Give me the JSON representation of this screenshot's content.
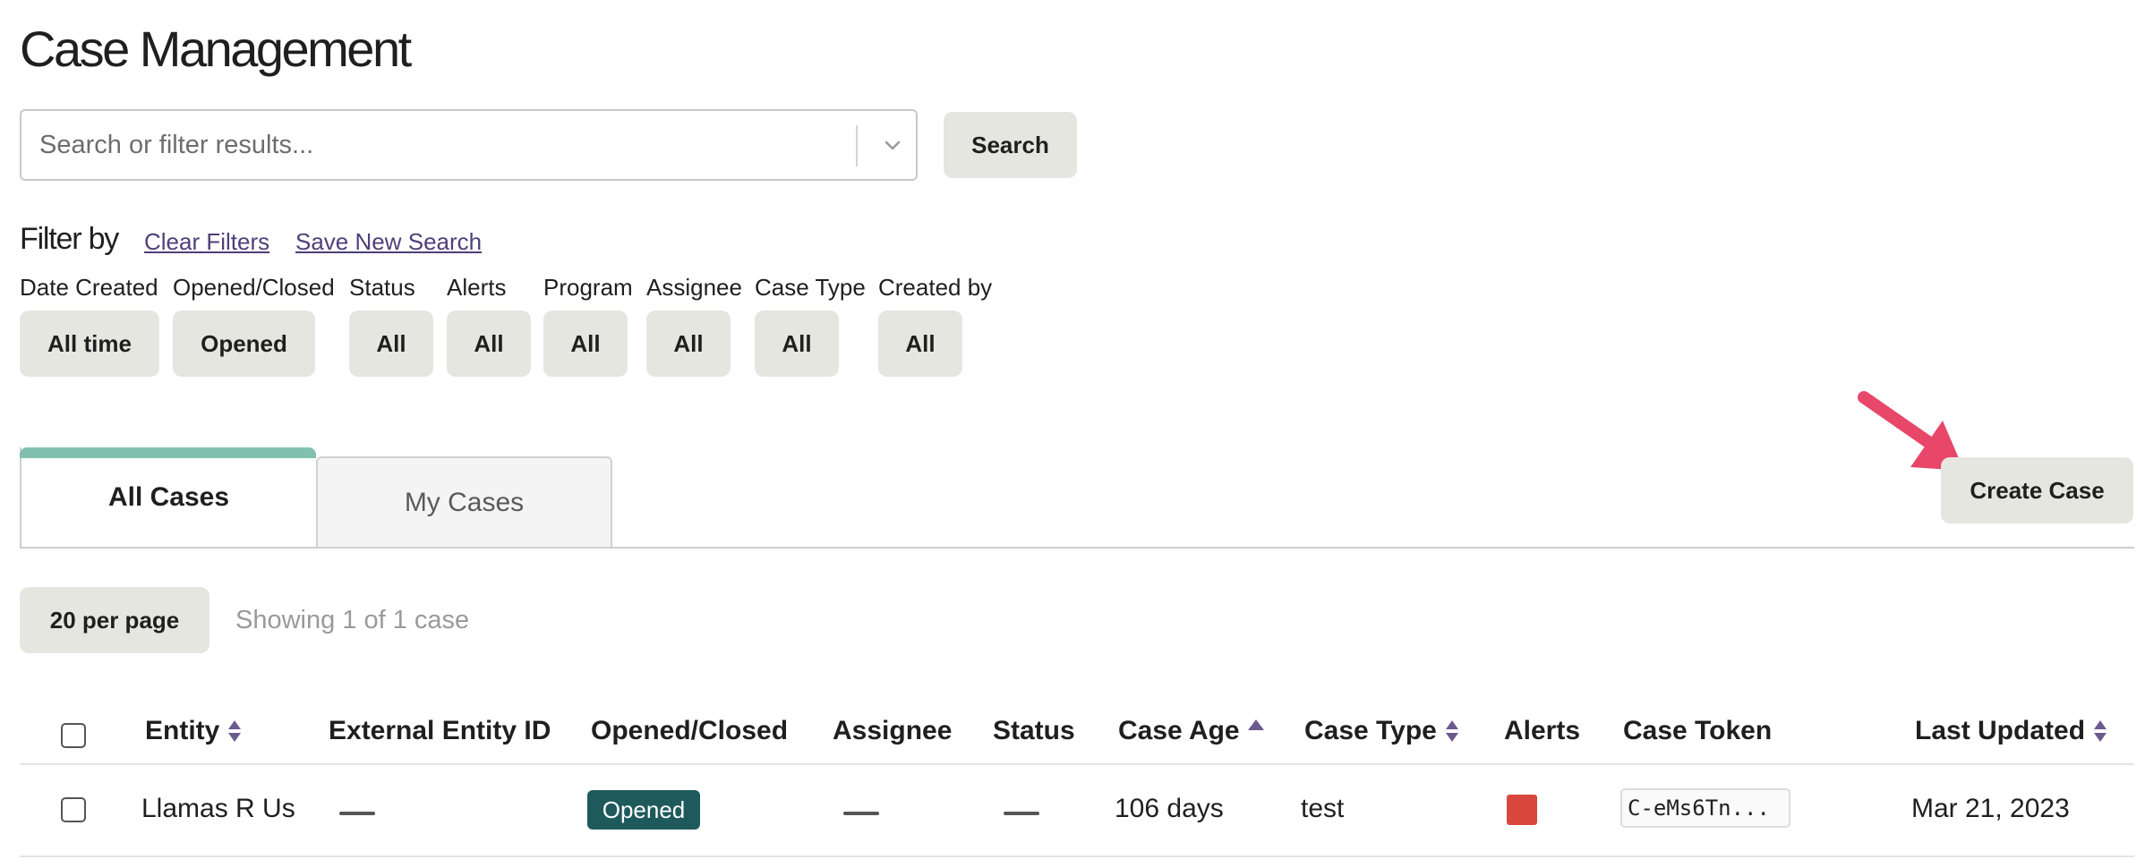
{
  "page": {
    "title": "Case Management"
  },
  "search": {
    "placeholder": "Search or filter results...",
    "button_label": "Search"
  },
  "filters": {
    "heading": "Filter by",
    "clear_label": "Clear Filters",
    "save_label": "Save New Search",
    "groups": [
      {
        "label": "Date Created",
        "value": "All time"
      },
      {
        "label": "Opened/Closed",
        "value": "Opened"
      },
      {
        "label": "Status",
        "value": "All"
      },
      {
        "label": "Alerts",
        "value": "All"
      },
      {
        "label": "Program",
        "value": "All"
      },
      {
        "label": "Assignee",
        "value": "All"
      },
      {
        "label": "Case Type",
        "value": "All"
      },
      {
        "label": "Created by",
        "value": "All"
      }
    ]
  },
  "tabs": [
    {
      "label": "All Cases",
      "active": true
    },
    {
      "label": "My Cases",
      "active": false
    }
  ],
  "actions": {
    "create_case_label": "Create Case"
  },
  "pagination": {
    "per_page_label": "20 per page",
    "showing_text": "Showing 1 of 1 case"
  },
  "table": {
    "columns": {
      "entity": "Entity",
      "external_id": "External Entity ID",
      "opened_closed": "Opened/Closed",
      "assignee": "Assignee",
      "status": "Status",
      "case_age": "Case Age",
      "case_type": "Case Type",
      "alerts": "Alerts",
      "case_token": "Case Token",
      "last_updated": "Last Updated"
    },
    "rows": [
      {
        "entity": "Llamas R Us",
        "opened_closed": "Opened",
        "case_age": "106 days",
        "case_type": "test",
        "case_token": "C-eMs6Tn...",
        "last_updated": "Mar 21, 2023",
        "alert_color": "#d9473f"
      }
    ]
  },
  "colors": {
    "accent_tab": "#82c0ae",
    "badge_opened": "#1e5a5c",
    "link": "#4f3f7a",
    "arrow": "#e8476a"
  }
}
